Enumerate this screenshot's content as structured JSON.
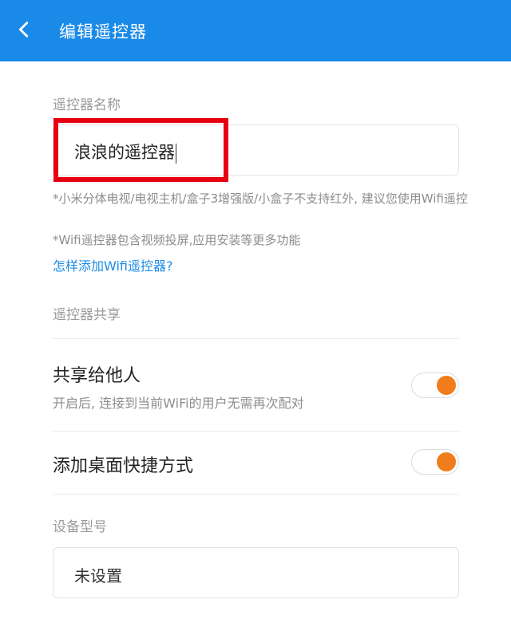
{
  "header": {
    "title": "编辑遥控器",
    "back_icon": "chevron-left-icon",
    "background": "#1a8ae8"
  },
  "name_section": {
    "label": "遥控器名称",
    "input_value": "浪浪的遥控器",
    "hint1": "*小米分体电视/电视主机/盒子3增强版/小盒子不支持红外, 建议您使用Wifi遥控",
    "hint2": "*Wifi遥控器包含视频投屏,应用安装等更多功能",
    "help_link": "怎样添加Wifi遥控器?"
  },
  "share_section": {
    "label": "遥控器共享",
    "share_title": "共享给他人",
    "share_desc": "开启后, 连接到当前WiFi的用户无需再次配对",
    "share_on": true,
    "shortcut_title": "添加桌面快捷方式",
    "shortcut_on": true
  },
  "model_section": {
    "label": "设备型号",
    "input_value": "未设置"
  },
  "colors": {
    "accent": "#1a8ae8",
    "toggle_on": "#f07c1b",
    "highlight": "#e60012"
  }
}
